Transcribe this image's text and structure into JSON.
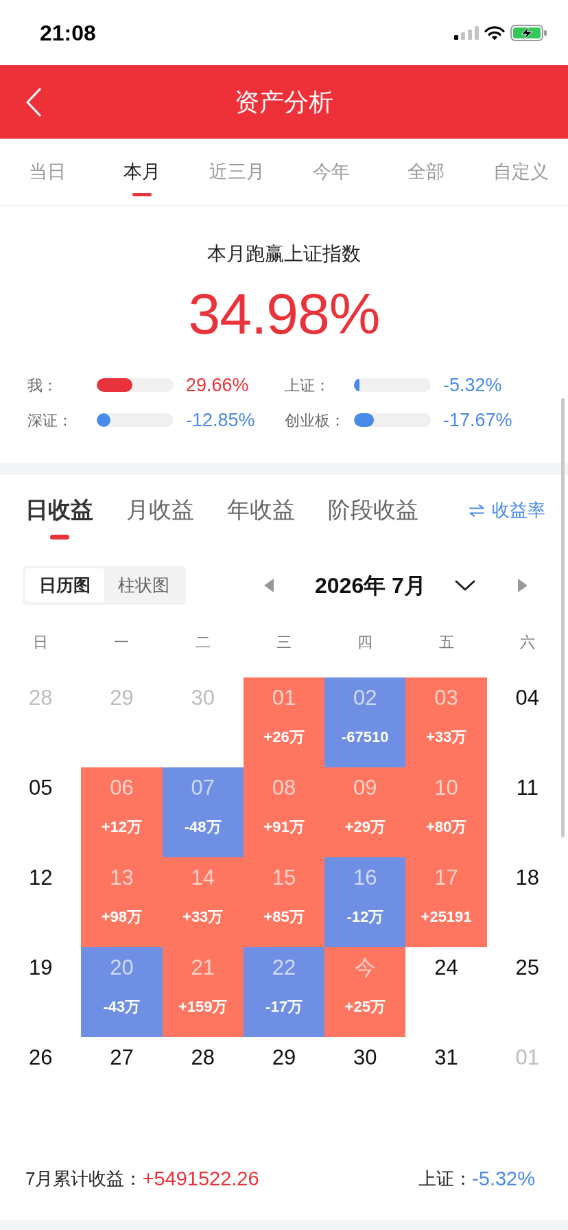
{
  "status_bar": {
    "time": "21:08"
  },
  "header": {
    "title": "资产分析"
  },
  "range_tabs": [
    {
      "label": "当日",
      "selected": false
    },
    {
      "label": "本月",
      "selected": true
    },
    {
      "label": "近三月",
      "selected": false
    },
    {
      "label": "今年",
      "selected": false
    },
    {
      "label": "全部",
      "selected": false
    },
    {
      "label": "自定义",
      "selected": false
    }
  ],
  "summary": {
    "title": "本月跑赢上证指数",
    "value": "34.98%",
    "comparisons": [
      {
        "label": "我：",
        "level": 0.46,
        "color": "#e8333a",
        "value": "29.66%"
      },
      {
        "label": "上证：",
        "level": 0.07,
        "color": "#4a8ae8",
        "value": "-5.32%"
      },
      {
        "label": "深证：",
        "level": 0.18,
        "color": "#4a8ae8",
        "value": "-12.85%"
      },
      {
        "label": "创业板：",
        "level": 0.26,
        "color": "#4a8ae8",
        "value": "-17.67%"
      }
    ]
  },
  "earnings_tabs": [
    {
      "label": "日收益",
      "selected": true
    },
    {
      "label": "月收益",
      "selected": false
    },
    {
      "label": "年收益",
      "selected": false
    },
    {
      "label": "阶段收益",
      "selected": false
    }
  ],
  "rate_toggle": {
    "label": "收益率"
  },
  "view_toggle": [
    {
      "label": "日历图",
      "selected": true
    },
    {
      "label": "柱状图",
      "selected": false
    }
  ],
  "month": {
    "title": "2026年 7月"
  },
  "weekdays": [
    "日",
    "一",
    "二",
    "三",
    "四",
    "五",
    "六"
  ],
  "calendar": {
    "weeks": [
      [
        {
          "day": "28",
          "kind": "outside"
        },
        {
          "day": "29",
          "kind": "outside"
        },
        {
          "day": "30",
          "kind": "outside"
        },
        {
          "day": "01",
          "kind": "gain",
          "amount": "+26万"
        },
        {
          "day": "02",
          "kind": "loss",
          "amount": "-67510"
        },
        {
          "day": "03",
          "kind": "gain",
          "amount": "+33万"
        },
        {
          "day": "04",
          "kind": "plain"
        }
      ],
      [
        {
          "day": "05",
          "kind": "plain"
        },
        {
          "day": "06",
          "kind": "gain",
          "amount": "+12万"
        },
        {
          "day": "07",
          "kind": "loss",
          "amount": "-48万"
        },
        {
          "day": "08",
          "kind": "gain",
          "amount": "+91万"
        },
        {
          "day": "09",
          "kind": "gain",
          "amount": "+29万"
        },
        {
          "day": "10",
          "kind": "gain",
          "amount": "+80万"
        },
        {
          "day": "11",
          "kind": "plain"
        }
      ],
      [
        {
          "day": "12",
          "kind": "plain"
        },
        {
          "day": "13",
          "kind": "gain",
          "amount": "+98万"
        },
        {
          "day": "14",
          "kind": "gain",
          "amount": "+33万"
        },
        {
          "day": "15",
          "kind": "gain",
          "amount": "+85万"
        },
        {
          "day": "16",
          "kind": "loss",
          "amount": "-12万"
        },
        {
          "day": "17",
          "kind": "gain",
          "amount": "+25191"
        },
        {
          "day": "18",
          "kind": "plain"
        }
      ],
      [
        {
          "day": "19",
          "kind": "plain"
        },
        {
          "day": "20",
          "kind": "loss",
          "amount": "-43万"
        },
        {
          "day": "21",
          "kind": "gain",
          "amount": "+159万"
        },
        {
          "day": "22",
          "kind": "loss",
          "amount": "-17万"
        },
        {
          "day": "今",
          "kind": "gain",
          "amount": "+25万"
        },
        {
          "day": "24",
          "kind": "plain"
        },
        {
          "day": "25",
          "kind": "plain"
        }
      ],
      [
        {
          "day": "26",
          "kind": "plain"
        },
        {
          "day": "27",
          "kind": "plain"
        },
        {
          "day": "28",
          "kind": "plain"
        },
        {
          "day": "29",
          "kind": "plain"
        },
        {
          "day": "30",
          "kind": "plain"
        },
        {
          "day": "31",
          "kind": "plain"
        },
        {
          "day": "01",
          "kind": "outside"
        }
      ]
    ]
  },
  "footer": {
    "label": "7月累计收益：",
    "value": "+5491522.26",
    "index_label": "上证：",
    "index_value": "-5.32%"
  }
}
